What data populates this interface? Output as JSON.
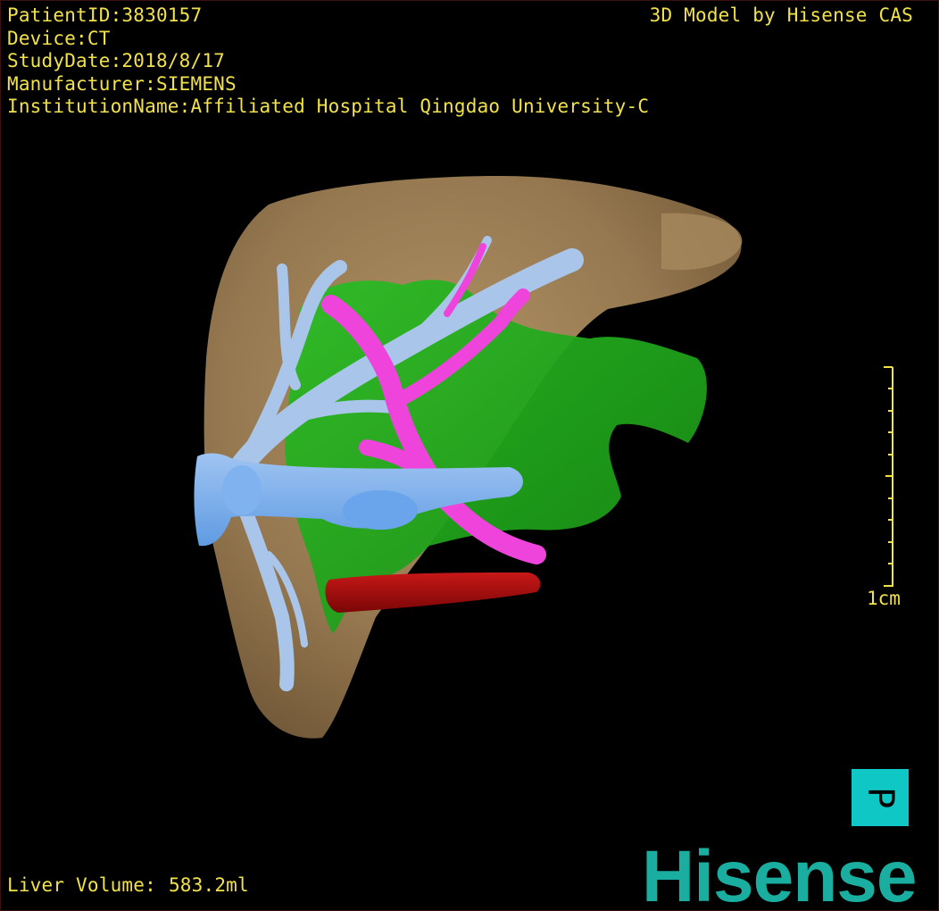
{
  "viewer": {
    "patient_id": "PatientID:3830157",
    "device": "Device:CT",
    "study_date": "StudyDate:2018/8/17",
    "manufacturer": "Manufacturer:SIEMENS",
    "institution": "InstitutionName:Affiliated Hospital Qingdao University-C",
    "model_credit": "3D Model by Hisense CAS",
    "liver_volume_label": "Liver Volume:",
    "liver_volume_value": "583.2ml",
    "scale_label": "1cm",
    "orientation_letter": "P",
    "brand_logo": "Hisense"
  },
  "colors": {
    "overlay_text": "#f2e24a",
    "liver": "#9c7f55",
    "tumor_green": "#22a81e",
    "portal_vein_light_blue": "#a9c5ea",
    "ivc_blue": "#6da8ec",
    "artery_magenta": "#ee44dc",
    "aorta_red": "#a00c0c",
    "orientation_cube": "#0fc8c6",
    "brand": "#1aaea0"
  },
  "icons": {
    "orientation_cube": "orientation-cube-icon",
    "scale_bar": "scale-bar-icon"
  }
}
